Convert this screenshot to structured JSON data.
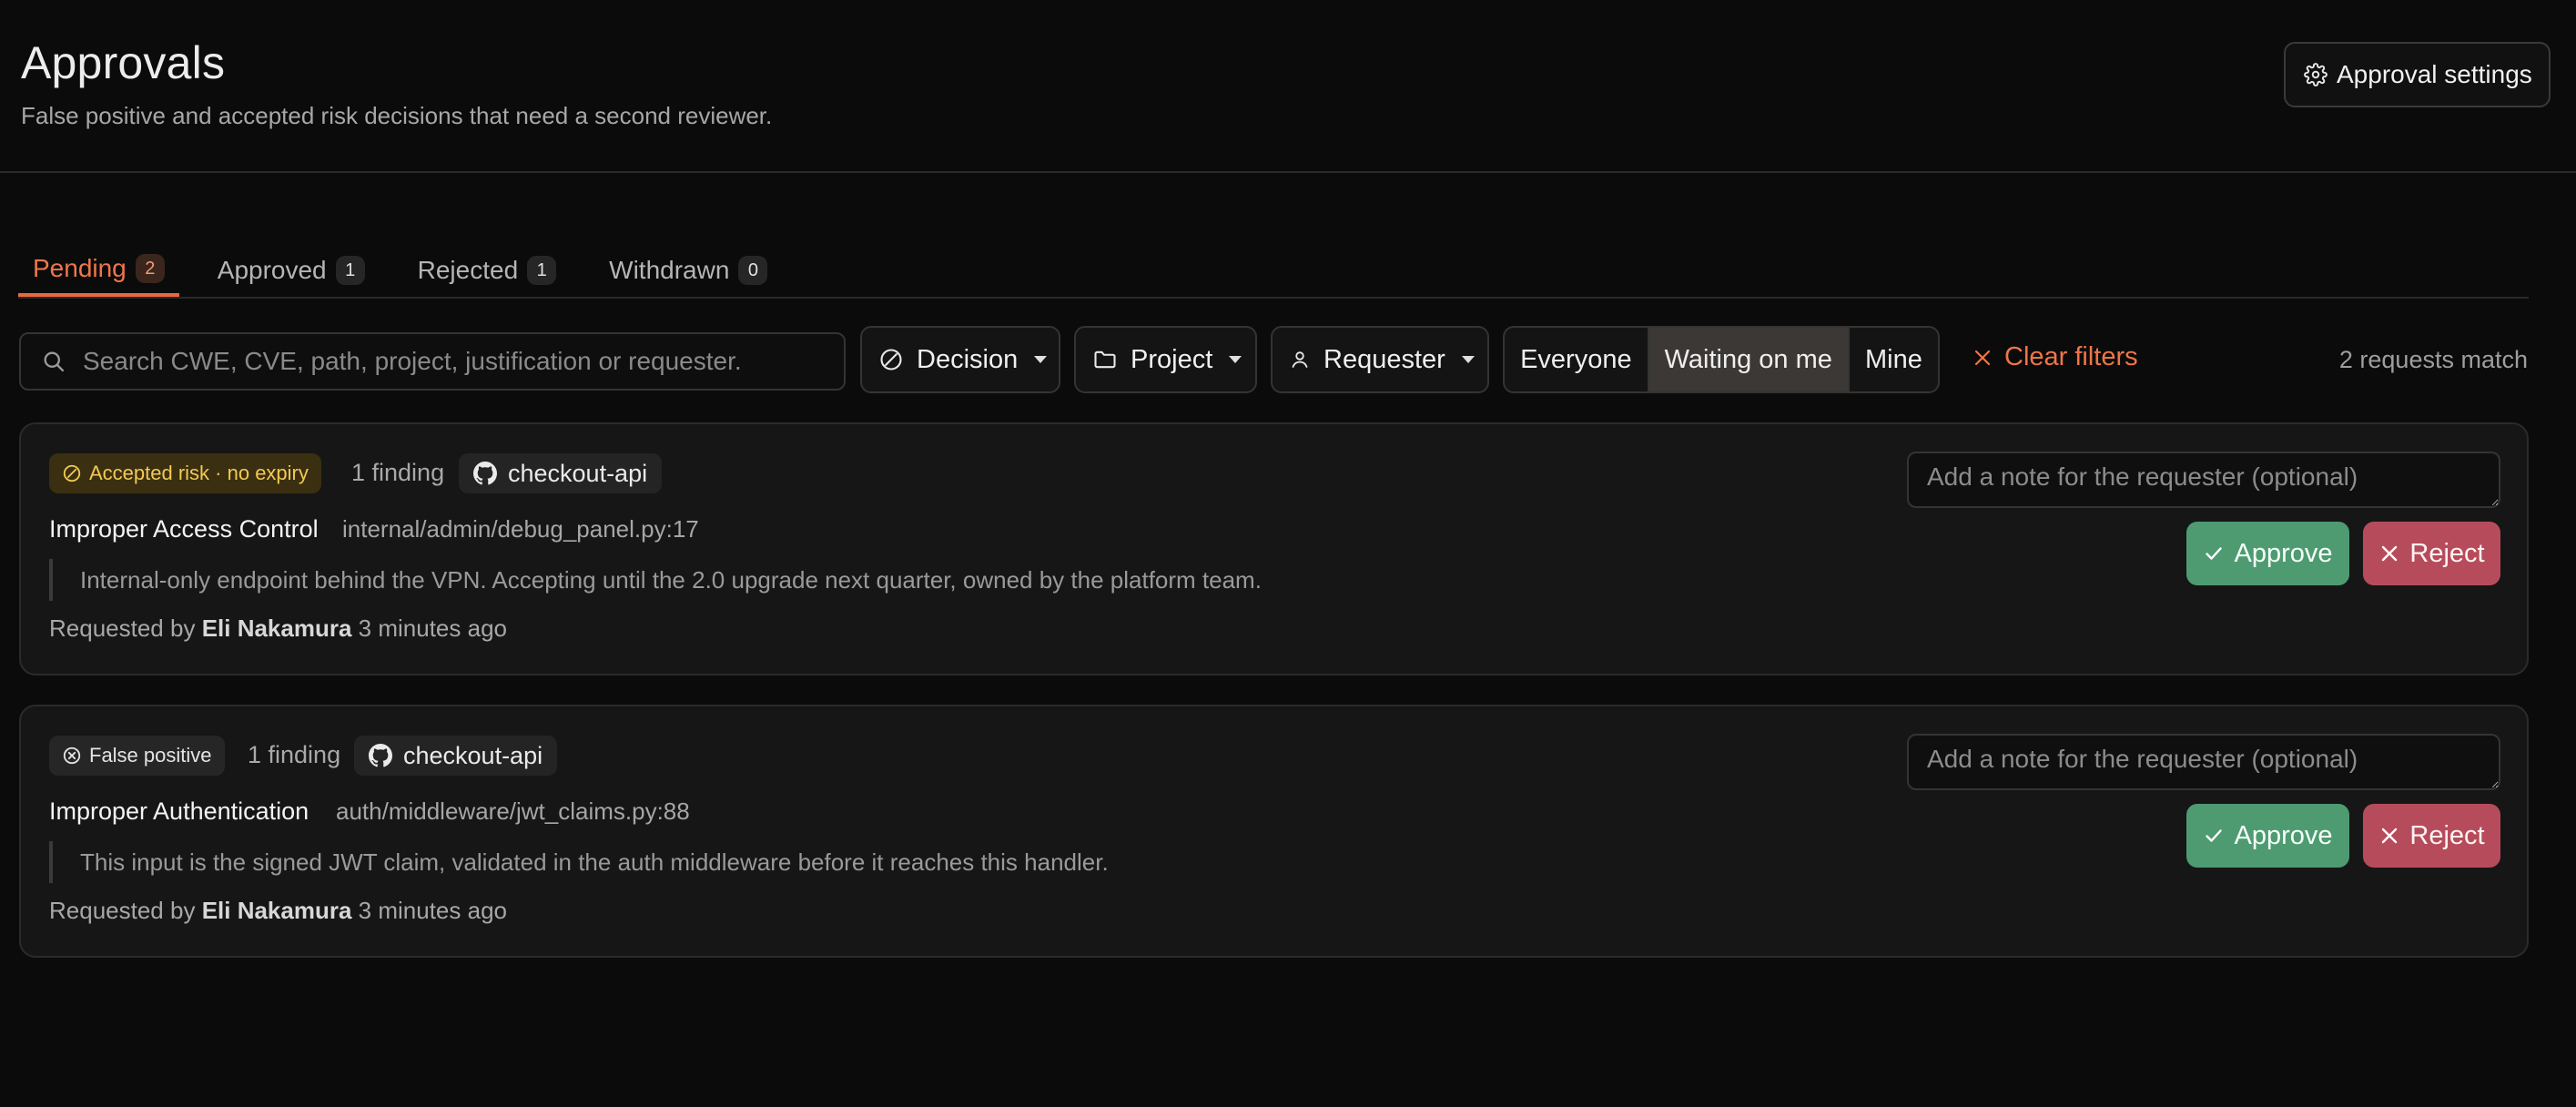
{
  "header": {
    "title": "Approvals",
    "subtitle": "False positive and accepted risk decisions that need a second reviewer.",
    "settings_label": "Approval settings"
  },
  "tabs": [
    {
      "label": "Pending",
      "count": "2",
      "active": true
    },
    {
      "label": "Approved",
      "count": "1",
      "active": false
    },
    {
      "label": "Rejected",
      "count": "1",
      "active": false
    },
    {
      "label": "Withdrawn",
      "count": "0",
      "active": false
    }
  ],
  "filters": {
    "search_placeholder": "Search CWE, CVE, path, project, justification or requester.",
    "decision_label": "Decision",
    "project_label": "Project",
    "requester_label": "Requester",
    "segments": [
      {
        "label": "Everyone",
        "active": false
      },
      {
        "label": "Waiting on me",
        "active": true
      },
      {
        "label": "Mine",
        "active": false
      }
    ],
    "clear_label": "Clear filters",
    "match_count": "2 requests match"
  },
  "requests": [
    {
      "decision": "Accepted risk · no expiry",
      "decision_type": "accepted-risk",
      "finding_count": "1 finding",
      "project": "checkout-api",
      "title": "Improper Access Control",
      "path": "internal/admin/debug_panel.py:17",
      "justification": "Internal-only endpoint behind the VPN. Accepting until the 2.0 upgrade next quarter, owned by the platform team.",
      "requested_prefix": "Requested by",
      "requester": "Eli Nakamura",
      "time": "3 minutes ago",
      "note_placeholder": "Add a note for the requester (optional)",
      "approve_label": "Approve",
      "reject_label": "Reject"
    },
    {
      "decision": "False positive",
      "decision_type": "false-positive",
      "finding_count": "1 finding",
      "project": "checkout-api",
      "title": "Improper Authentication",
      "path": "auth/middleware/jwt_claims.py:88",
      "justification": "This input is the signed JWT claim, validated in the auth middleware before it reaches this handler.",
      "requested_prefix": "Requested by",
      "requester": "Eli Nakamura",
      "time": "3 minutes ago",
      "note_placeholder": "Add a note for the requester (optional)",
      "approve_label": "Approve",
      "reject_label": "Reject"
    }
  ],
  "colors": {
    "accent": "#e8693e",
    "approve": "#4e9b72",
    "reject": "#b64c5b",
    "accepted_badge_text": "#f3c955"
  }
}
